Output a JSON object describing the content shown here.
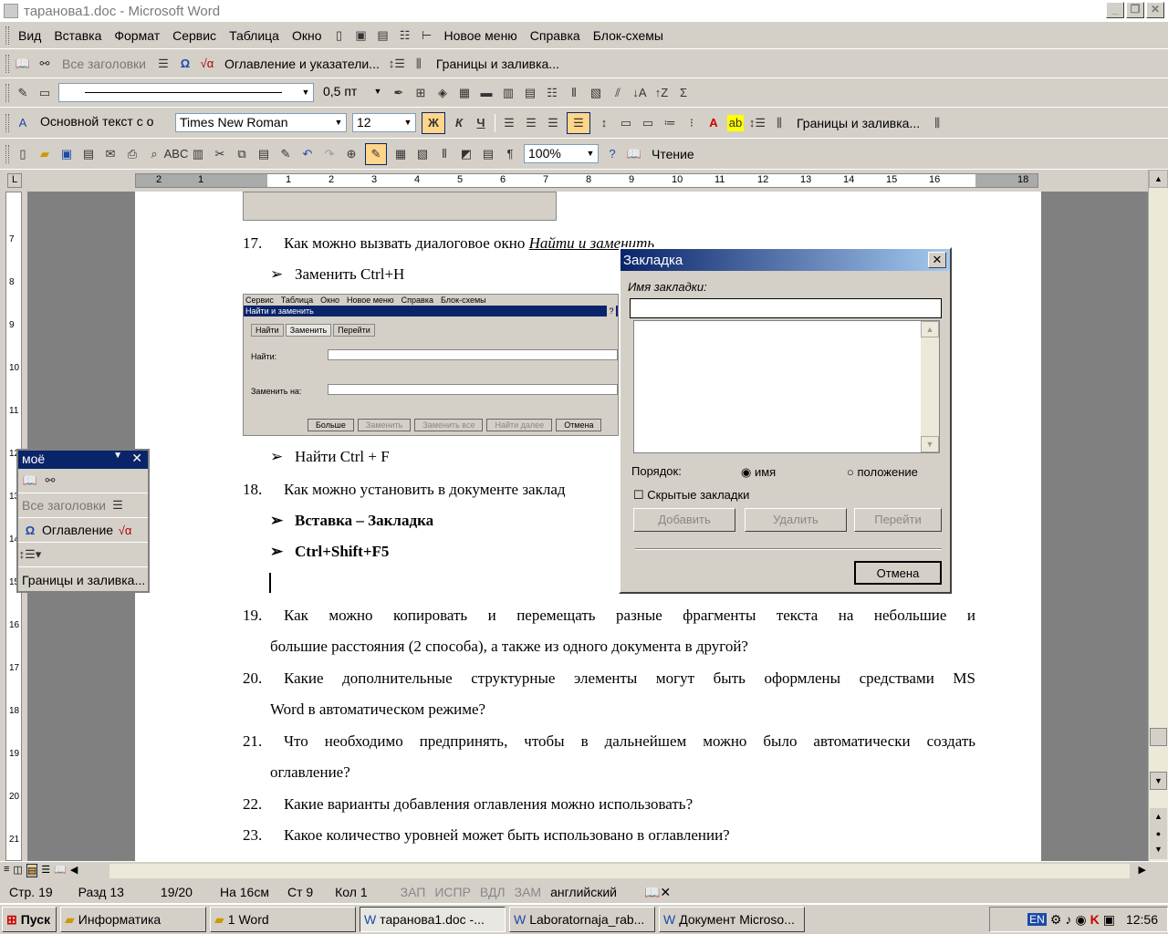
{
  "window": {
    "title": "таранова1.doc - Microsoft Word",
    "min": "_",
    "restore": "❐",
    "close": "✕"
  },
  "menubar": {
    "items": [
      "Вид",
      "Вставка",
      "Формат",
      "Сервис",
      "Таблица",
      "Окно"
    ],
    "extra": [
      "Новое меню",
      "Справка",
      "Блок-схемы"
    ]
  },
  "toolbar2": {
    "all_headings": "Все заголовки",
    "toc": "Оглавление и указатели...",
    "borders": "Границы и заливка..."
  },
  "toolbar3": {
    "line_weight": "0,5 пт"
  },
  "format": {
    "style": "Основной текст с о",
    "font": "Times New Roman",
    "size": "12",
    "bold": "Ж",
    "italic": "К",
    "underline": "Ч",
    "borders": "Границы и заливка..."
  },
  "standard": {
    "zoom": "100%",
    "reading": "Чтение"
  },
  "ruler": {
    "marks": [
      "2",
      "1",
      "1",
      "2",
      "3",
      "4",
      "5",
      "6",
      "7",
      "8",
      "9",
      "10",
      "11",
      "12",
      "13",
      "14",
      "15",
      "16",
      "18"
    ],
    "vmarks": [
      "7",
      "8",
      "9",
      "10",
      "11",
      "12",
      "13",
      "14",
      "15",
      "16",
      "17",
      "18",
      "19",
      "20",
      "21"
    ]
  },
  "doc": {
    "q17": {
      "num": "17.",
      "text": "Как можно вызвать диалоговое окно ",
      "link": "Найти и заменить"
    },
    "b1": "Заменить Ctrl+H",
    "shot": {
      "menu": [
        "Сервис",
        "Таблица",
        "Окно",
        "Новое меню",
        "Справка",
        "Блок-схемы"
      ],
      "title": "Найти и заменить",
      "help": "?",
      "tabs": [
        "Найти",
        "Заменить",
        "Перейти"
      ],
      "find": "Найти:",
      "replace": "Заменить на:",
      "buttons": [
        "Больше",
        "Заменить",
        "Заменить все",
        "Найти далее",
        "Отмена"
      ]
    },
    "b2": "Найти Ctrl + F",
    "q18": {
      "num": "18.",
      "text": "Как можно установить в документе заклад"
    },
    "b3": "Вставка – Закладка",
    "b4": "Ctrl+Shift+F5",
    "q19": {
      "num": "19.",
      "line1": "Как можно копировать и перемещать разные фрагменты текста на небольшие и",
      "line2": "большие расстояния (2 способа), а также из одного документа в другой?"
    },
    "q20": {
      "num": "20.",
      "line1": "Какие дополнительные структурные элементы могут быть оформлены средствами MS",
      "line2": "Word в автоматическом режиме?"
    },
    "q21": {
      "num": "21.",
      "line1": "Что необходимо предпринять, чтобы в дальнейшем можно было автоматически создать",
      "line2": "оглавление?"
    },
    "q22": {
      "num": "22.",
      "text": "Какие варианты добавления оглавления можно использовать?"
    },
    "q23": {
      "num": "23.",
      "text": "Какое количество уровней может быть использовано в оглавлении?"
    }
  },
  "panel": {
    "title": "моё",
    "all_headings": "Все заголовки",
    "toc": "Оглавление",
    "borders": "Границы и заливка..."
  },
  "dialog": {
    "title": "Закладка",
    "name_label": "Имя закладки:",
    "name_value": "",
    "order_label": "Порядок:",
    "opt_name": "имя",
    "opt_position": "положение",
    "order_selected": "имя",
    "hidden_label": "Скрытые закладки",
    "hidden_checked": false,
    "add": "Добавить",
    "delete": "Удалить",
    "goto": "Перейти",
    "cancel": "Отмена"
  },
  "status": {
    "page": "Стр. 19",
    "section": "Разд 13",
    "pages": "19/20",
    "at": "На 16см",
    "line": "Ст 9",
    "col": "Кол 1",
    "rec": "ЗАП",
    "trk": "ИСПР",
    "ext": "ВДЛ",
    "ovr": "ЗАМ",
    "lang": "английский"
  },
  "taskbar": {
    "start": "Пуск",
    "tasks": [
      "Информатика",
      "1 Word",
      "таранова1.doc -...",
      "Laboratornaja_rab...",
      "Документ Microso..."
    ],
    "lang": "EN",
    "clock": "12:56"
  }
}
